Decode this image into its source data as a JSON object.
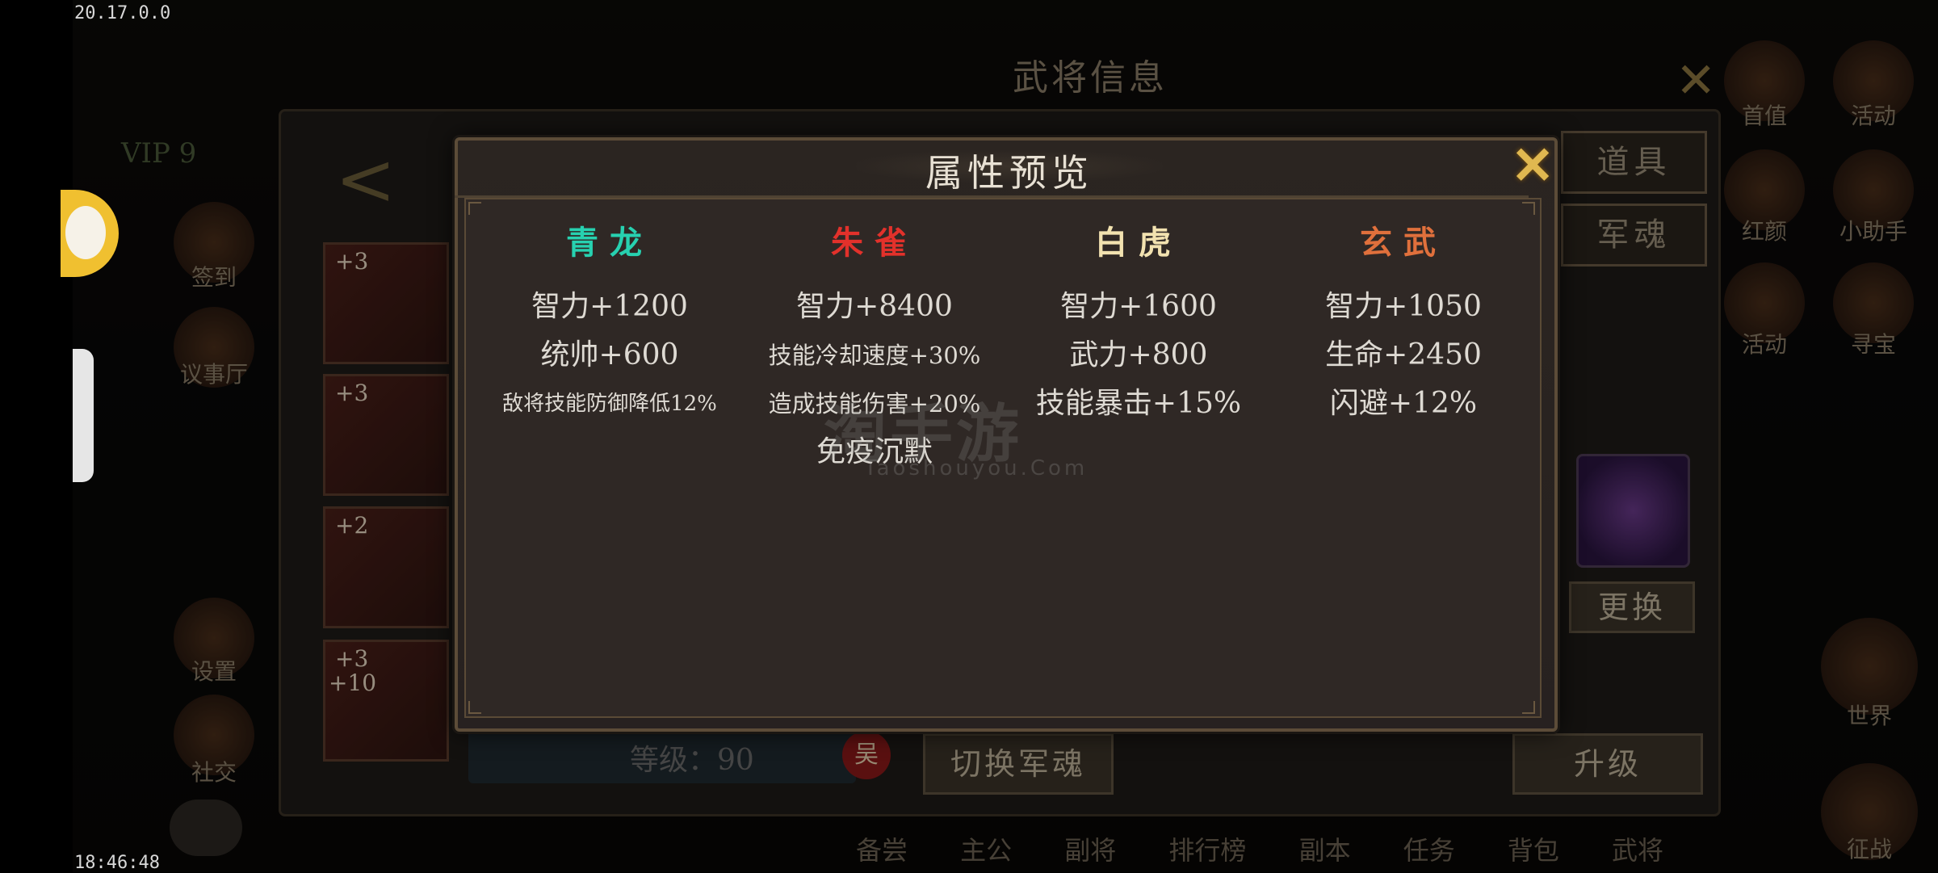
{
  "hud": {
    "version": "20.17.0.0",
    "time": "18:46:48"
  },
  "background": {
    "window_title": "武将信息",
    "vip": "VIP 9",
    "left_labels": [
      "签到",
      "议事厅",
      "设置",
      "社交"
    ],
    "right_labels": [
      "首值",
      "活动",
      "红颜",
      "小助手",
      "活动",
      "寻宝",
      "世界",
      "征战"
    ],
    "equip_levels": [
      "+3",
      "+3",
      "+2",
      "+3"
    ],
    "equip_extra": "+10",
    "tabs": [
      "道具",
      "军魂"
    ],
    "level_text": "等级：90",
    "wu_badge": "吴",
    "switch_button": "切换军魂",
    "upgrade_button": "升级",
    "replace_button": "更换",
    "bottom_nav": [
      "备尝",
      "主公",
      "副将",
      "排行榜",
      "副本",
      "任务",
      "背包",
      "武将",
      "征战"
    ]
  },
  "modal": {
    "title": "属性预览",
    "columns": [
      {
        "name": "青龙",
        "color": "#27d1b0",
        "stats": [
          "智力+1200",
          "统帅+600",
          "敌将技能防御降低12%"
        ]
      },
      {
        "name": "朱雀",
        "color": "#e2312b",
        "stats": [
          "智力+8400",
          "技能冷却速度+30%",
          "造成技能伤害+20%",
          "免疫沉默"
        ]
      },
      {
        "name": "白虎",
        "color": "#f2e2b0",
        "stats": [
          "智力+1600",
          "武力+800",
          "技能暴击+15%"
        ]
      },
      {
        "name": "玄武",
        "color": "#e0703c",
        "stats": [
          "智力+1050",
          "生命+2450",
          "闪避+12%"
        ]
      }
    ]
  },
  "watermark": {
    "text": "淘手游",
    "sub": "Taoshouyou.Com"
  }
}
